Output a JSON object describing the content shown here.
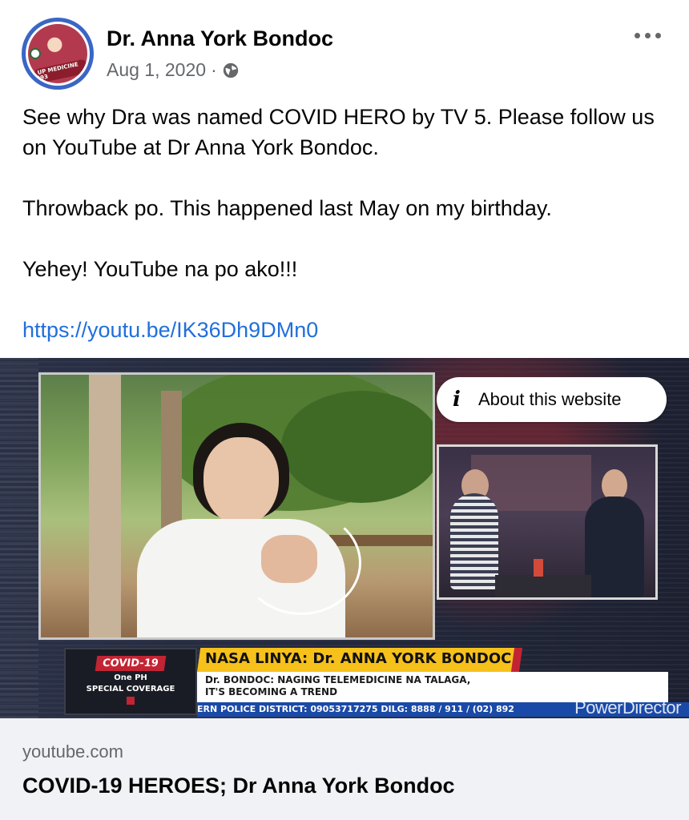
{
  "post": {
    "author": "Dr. Anna York Bondoc",
    "date": "Aug 1, 2020",
    "separator": "·",
    "privacy_icon": "globe-icon",
    "avatar_badge": "UP MEDICINE '93",
    "paragraphs": [
      "See why Dra was named COVID HERO by TV 5.  Please follow us on YouTube at Dr Anna York Bondoc.",
      "Throwback po.  This happened last May on my birthday.",
      "Yehey!  YouTube na po ako!!!"
    ],
    "link": "https://youtu.be/IK36Dh9DMn0"
  },
  "preview": {
    "about_button": "About this website",
    "covid_tag": "COVID-19",
    "covid_sub1": "One PH",
    "covid_sub2": "SPECIAL COVERAGE",
    "headline": "NASA LINYA: Dr. ANNA YORK BONDOC",
    "subline1": "Dr. BONDOC: NAGING TELEMEDICINE NA TALAGA,",
    "subline2": "IT'S BECOMING A TREND",
    "ticker": "ERN POLICE DISTRICT: 09053717275     DILG: 8888 / 911 / (02) 892",
    "watermark": "PowerDirector"
  },
  "link_card": {
    "domain": "youtube.com",
    "title": "COVID-19 HEROES; Dr Anna York Bondoc"
  },
  "colors": {
    "link": "#216fdb",
    "secondary_text": "#65676b",
    "card_bg": "#f0f2f5",
    "avatar_ring": "#3a66c4",
    "nasa_bar": "#f7c11b",
    "ticker_bar": "#1a4aa8"
  }
}
